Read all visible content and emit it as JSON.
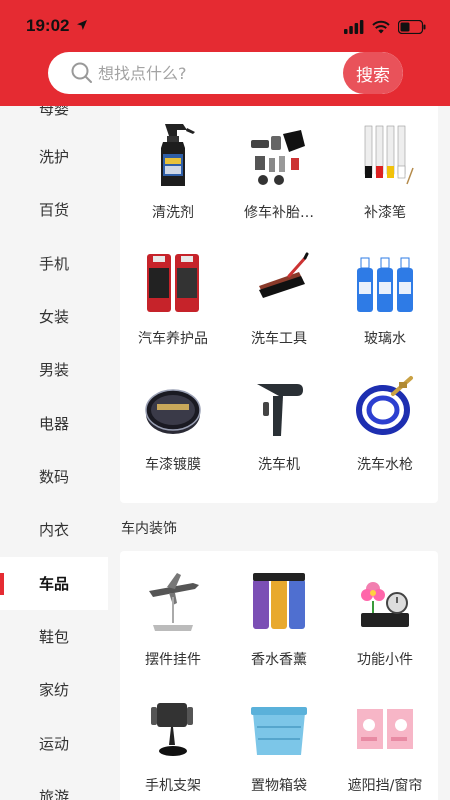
{
  "status_bar": {
    "time": "19:02"
  },
  "search": {
    "placeholder": "想找点什么?",
    "button_label": "搜索"
  },
  "sidebar": {
    "items": [
      {
        "label": "母婴"
      },
      {
        "label": "洗护"
      },
      {
        "label": "百货"
      },
      {
        "label": "手机"
      },
      {
        "label": "女装"
      },
      {
        "label": "男装"
      },
      {
        "label": "电器"
      },
      {
        "label": "数码"
      },
      {
        "label": "内衣"
      },
      {
        "label": "车品",
        "active": true
      },
      {
        "label": "鞋包"
      },
      {
        "label": "家纺"
      },
      {
        "label": "运动"
      },
      {
        "label": "旅游"
      }
    ]
  },
  "sections": [
    {
      "title": "",
      "items": [
        {
          "label": "清洗剂",
          "icon": "spray-bottle-icon"
        },
        {
          "label": "修车补胎…",
          "icon": "tire-repair-kit-icon"
        },
        {
          "label": "补漆笔",
          "icon": "paint-pen-icon"
        },
        {
          "label": "汽车养护品",
          "icon": "car-care-cans-icon"
        },
        {
          "label": "洗车工具",
          "icon": "car-brush-icon"
        },
        {
          "label": "玻璃水",
          "icon": "glass-cleaner-icon"
        },
        {
          "label": "车漆镀膜",
          "icon": "wax-tin-icon"
        },
        {
          "label": "洗车机",
          "icon": "spray-gun-icon"
        },
        {
          "label": "洗车水枪",
          "icon": "hose-icon"
        }
      ]
    },
    {
      "title": "车内装饰",
      "items": [
        {
          "label": "摆件挂件",
          "icon": "airplane-ornament-icon"
        },
        {
          "label": "香水香薰",
          "icon": "perfume-icon"
        },
        {
          "label": "功能小件",
          "icon": "dashboard-gadget-icon"
        },
        {
          "label": "手机支架",
          "icon": "phone-holder-icon"
        },
        {
          "label": "置物箱袋",
          "icon": "storage-box-icon"
        },
        {
          "label": "遮阳挡/窗帘",
          "icon": "sunshade-icon"
        }
      ]
    }
  ],
  "colors": {
    "accent": "#e52b32",
    "search_button": "#e9525a"
  }
}
